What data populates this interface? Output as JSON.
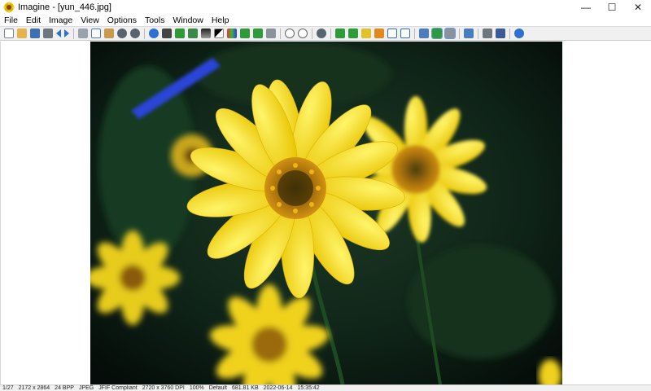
{
  "window": {
    "app_name": "Imagine",
    "title": "Imagine - [yun_446.jpg]",
    "minimize_glyph": "—",
    "maximize_glyph": "☐",
    "close_glyph": "✕"
  },
  "menu": {
    "items": [
      {
        "label": "File"
      },
      {
        "label": "Edit"
      },
      {
        "label": "Image"
      },
      {
        "label": "View"
      },
      {
        "label": "Options"
      },
      {
        "label": "Tools"
      },
      {
        "label": "Window"
      },
      {
        "label": "Help"
      }
    ]
  },
  "toolbar": {
    "colors": {
      "blue": "#2f6fd0",
      "green": "#2e9b3a",
      "gray": "#6f7680",
      "orange": "#e08a1e",
      "yellow": "#e0c22a"
    }
  },
  "image": {
    "filename": "yun_446.jpg",
    "subject": "yellow daisy flowers"
  },
  "status": {
    "cells": [
      "1/27",
      "2172 x 2864",
      "24 BPP",
      "JPEG",
      "JFIF Compliant",
      "2720 x 3760 DPI",
      "100%",
      "Default",
      "681.81 KB",
      "2022-06-14",
      "15:35:42"
    ]
  }
}
